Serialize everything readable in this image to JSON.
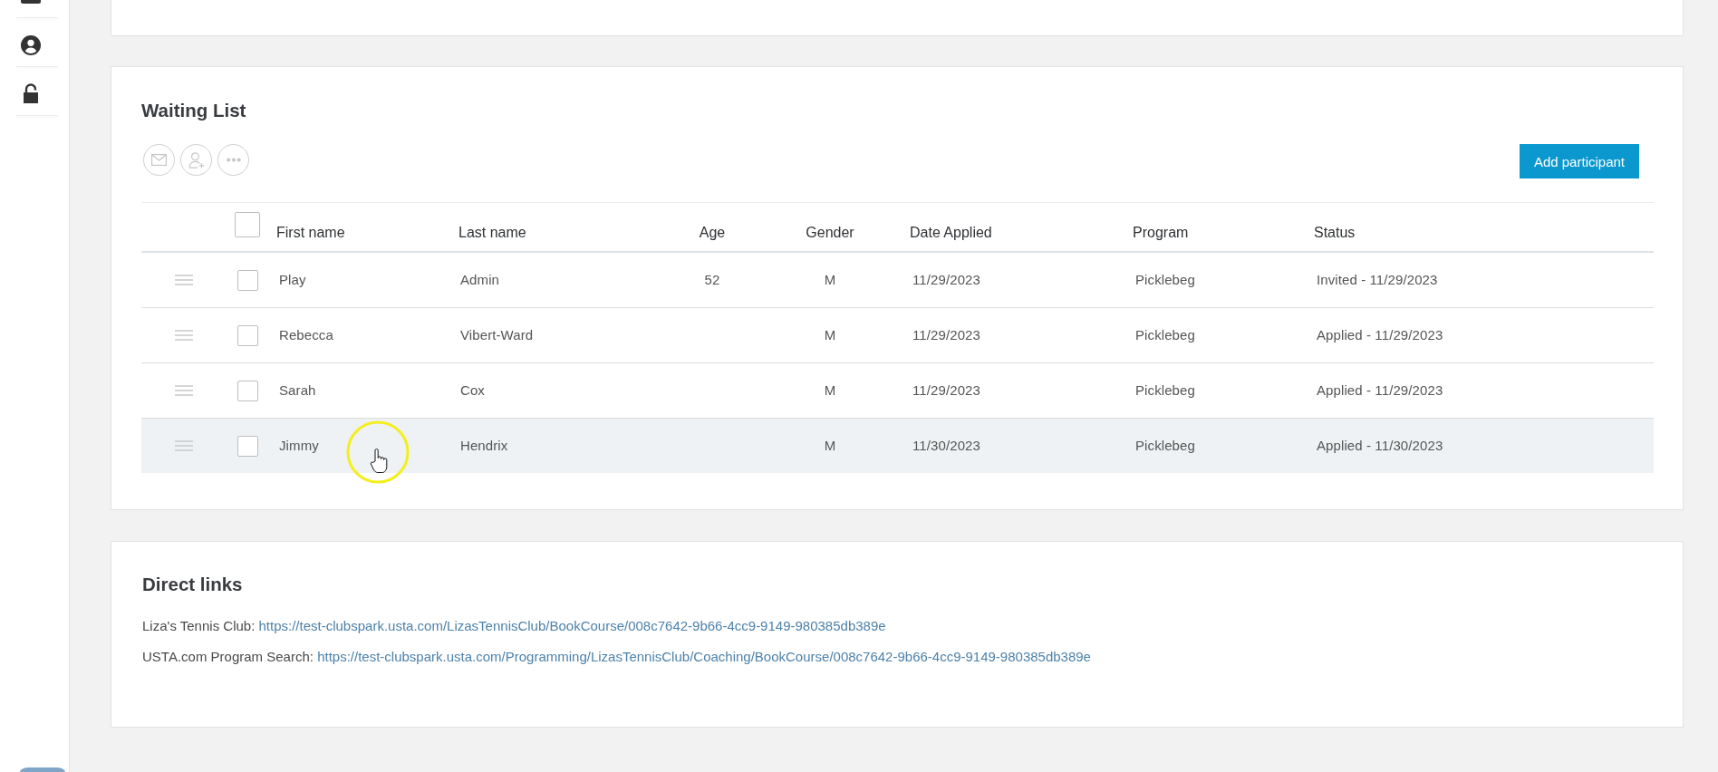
{
  "waiting_list": {
    "title": "Waiting List",
    "actions": [
      {
        "kind": "email",
        "disabled": true
      },
      {
        "kind": "add_person",
        "disabled": true
      },
      {
        "kind": "more",
        "disabled": true
      }
    ],
    "add_button": "Add participant",
    "table": {
      "select_all": {
        "checked": false
      },
      "columns": [
        "First name",
        "Last name",
        "Age",
        "Gender",
        "Date Applied",
        "Program",
        "Status"
      ],
      "rows": [
        {
          "checked": false,
          "highlighted": false,
          "first_name": "Play",
          "last_name": "Admin",
          "age": "52",
          "gender": "M",
          "date_applied": "11/29/2023",
          "program": "Picklebeg",
          "status": "Invited - 11/29/2023"
        },
        {
          "checked": false,
          "highlighted": false,
          "first_name": "Rebecca",
          "last_name": "Vibert-Ward",
          "gender": "M",
          "date_applied": "11/29/2023",
          "program": "Picklebeg",
          "status": "Applied - 11/29/2023"
        },
        {
          "checked": false,
          "highlighted": false,
          "first_name": "Sarah",
          "last_name": "Cox",
          "gender": "M",
          "date_applied": "11/29/2023",
          "program": "Picklebeg",
          "status": "Applied - 11/29/2023"
        },
        {
          "checked": false,
          "highlighted": true,
          "first_name": "Jimmy",
          "last_name": "Hendrix",
          "gender": "M",
          "date_applied": "11/30/2023",
          "program": "Picklebeg",
          "status": "Applied - 11/30/2023"
        }
      ]
    }
  },
  "direct_links": {
    "title": "Direct links",
    "links": [
      {
        "label": "Liza's Tennis Club:",
        "url": "https://test-clubspark.usta.com/LizasTennisClub/BookCourse/008c7642-9b66-4cc9-9149-980385db389e"
      },
      {
        "label": "USTA.com Program Search:",
        "url": "https://test-clubspark.usta.com/Programming/LizasTennisClub/Coaching/BookCourse/008c7642-9b66-4cc9-9149-980385db389e"
      }
    ]
  }
}
